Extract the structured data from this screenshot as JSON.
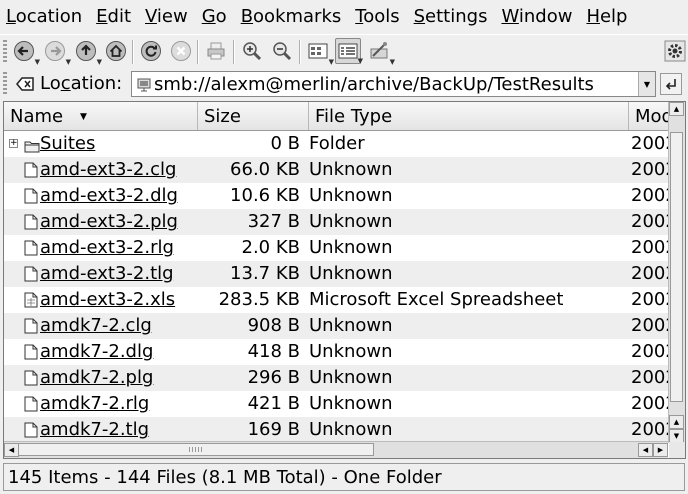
{
  "menubar": {
    "items": [
      {
        "first": "L",
        "rest": "ocation"
      },
      {
        "first": "E",
        "rest": "dit"
      },
      {
        "first": "V",
        "rest": "iew"
      },
      {
        "first": "G",
        "rest": "o"
      },
      {
        "first": "B",
        "rest": "ookmarks"
      },
      {
        "first": "T",
        "rest": "ools"
      },
      {
        "first": "S",
        "rest": "ettings"
      },
      {
        "first": "W",
        "rest": "indow"
      },
      {
        "first": "H",
        "rest": "elp"
      }
    ]
  },
  "toolbar": {
    "icons": [
      "back-icon",
      "forward-icon",
      "up-icon",
      "home-icon",
      "reload-icon",
      "stop-icon",
      "print-icon",
      "zoom-in-icon",
      "zoom-out-icon",
      "icon-view-icon",
      "detailed-view-icon",
      "split-view-icon",
      "settings-gear-icon"
    ]
  },
  "locationbar": {
    "label_first": "Lo",
    "label_underlined": "c",
    "label_rest": "ation:",
    "url": "smb://alexm@merlin/archive/BackUp/TestResults"
  },
  "columns": {
    "name": "Name",
    "size": "Size",
    "type": "File Type",
    "modified": "Mod"
  },
  "files": [
    {
      "name": "Suites",
      "size": "0 B",
      "type": "Folder",
      "modified": "2002",
      "kind": "folder"
    },
    {
      "name": "amd-ext3-2.clg",
      "size": "66.0 KB",
      "type": "Unknown",
      "modified": "2002",
      "kind": "file"
    },
    {
      "name": "amd-ext3-2.dlg",
      "size": "10.6 KB",
      "type": "Unknown",
      "modified": "2002",
      "kind": "file"
    },
    {
      "name": "amd-ext3-2.plg",
      "size": "327 B",
      "type": "Unknown",
      "modified": "2002",
      "kind": "file"
    },
    {
      "name": "amd-ext3-2.rlg",
      "size": "2.0 KB",
      "type": "Unknown",
      "modified": "2002",
      "kind": "file"
    },
    {
      "name": "amd-ext3-2.tlg",
      "size": "13.7 KB",
      "type": "Unknown",
      "modified": "2002",
      "kind": "file"
    },
    {
      "name": "amd-ext3-2.xls",
      "size": "283.5 KB",
      "type": "Microsoft Excel Spreadsheet",
      "modified": "2002",
      "kind": "sheet"
    },
    {
      "name": "amdk7-2.clg",
      "size": "908 B",
      "type": "Unknown",
      "modified": "2002",
      "kind": "file"
    },
    {
      "name": "amdk7-2.dlg",
      "size": "418 B",
      "type": "Unknown",
      "modified": "2002",
      "kind": "file"
    },
    {
      "name": "amdk7-2.plg",
      "size": "296 B",
      "type": "Unknown",
      "modified": "2002",
      "kind": "file"
    },
    {
      "name": "amdk7-2.rlg",
      "size": "421 B",
      "type": "Unknown",
      "modified": "2002",
      "kind": "file"
    },
    {
      "name": "amdk7-2.tlg",
      "size": "169 B",
      "type": "Unknown",
      "modified": "2002",
      "kind": "file"
    }
  ],
  "status": {
    "text": "145 Items - 144 Files (8.1 MB Total) - One Folder"
  }
}
